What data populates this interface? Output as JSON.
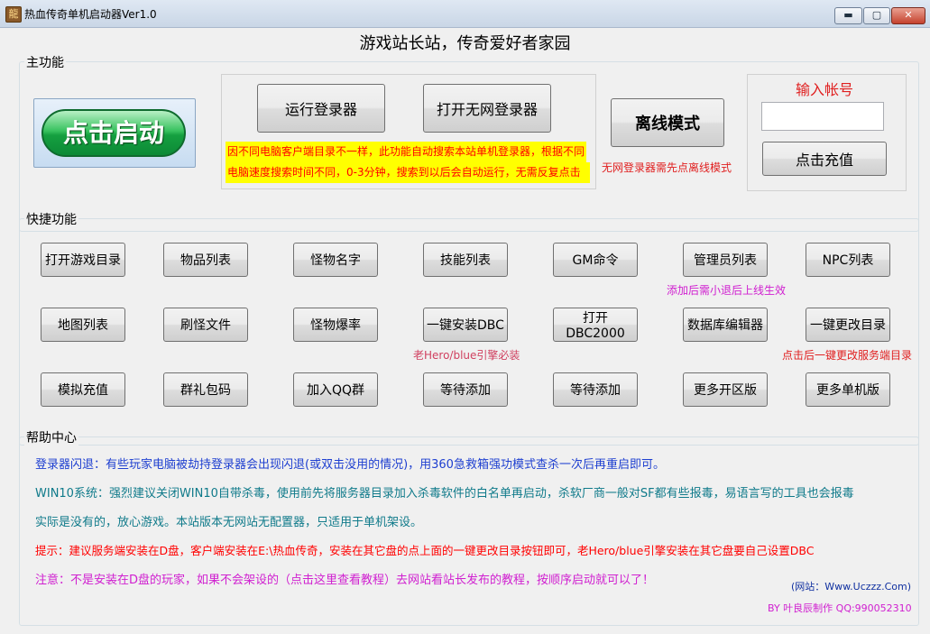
{
  "window": {
    "title": "热血传奇单机启动器Ver1.0",
    "icon_glyph": "龍",
    "minimize_glyph": "▬",
    "maximize_glyph": "▢",
    "close_glyph": "✕"
  },
  "slogan": "游戏站长站，传奇爱好者家园",
  "main_group": {
    "label": "主功能",
    "start_button": "点击启动",
    "run_login_button": "运行登录器",
    "open_offline_login_button": "打开无网登录器",
    "notice_line1": "因不同电脑客户端目录不一样，此功能自动搜索本站单机登录器，根据不同",
    "notice_line2": "电脑速度搜索时间不同，0-3分钟，搜索到以后会自动运行，无需反复点击",
    "offline_mode_button": "离线模式",
    "offline_note": "无网登录器需先点离线模式",
    "account_label": "输入帐号",
    "account_value": "",
    "recharge_button": "点击充值"
  },
  "quick_group": {
    "label": "快捷功能",
    "row1": [
      "打开游戏目录",
      "物品列表",
      "怪物名字",
      "技能列表",
      "GM命令",
      "管理员列表",
      "NPC列表"
    ],
    "row2": [
      "地图列表",
      "刷怪文件",
      "怪物爆率",
      "一键安装DBC",
      "打开DBC2000",
      "数据库编辑器",
      "一键更改目录"
    ],
    "row3": [
      "模拟充值",
      "群礼包码",
      "加入QQ群",
      "等待添加",
      "等待添加",
      "更多开区版",
      "更多单机版"
    ],
    "admin_note": "添加后需小退后上线生效",
    "dbc_note": "老Hero/blue引擎必装",
    "dir_note": "点击后一键更改服务端目录"
  },
  "help_group": {
    "label": "帮助中心",
    "line1": "登录器闪退：有些玩家电脑被劫持登录器会出现闪退(或双击没用的情况)，用360急救箱强功模式查杀一次后再重启即可。",
    "line2": "WIN10系统：强烈建议关闭WIN10自带杀毒，使用前先将服务器目录加入杀毒软件的白名单再启动，杀软厂商一般对SF都有些报毒，易语言写的工具也会报毒",
    "line3": "实际是没有的，放心游戏。本站版本无网站无配置器，只适用于单机架设。",
    "line4": "提示：建议服务端安装在D盘，客户端安装在E:\\热血传奇，安装在其它盘的点上面的一键更改目录按钮即可，老Hero/blue引擎安装在其它盘要自己设置DBC",
    "line5": "注意：不是安装在D盘的玩家，如果不会架设的（点击这里查看教程）去网站看站长发布的教程，按顺序启动就可以了！",
    "website": "(网站：Www.Uczzz.Com)",
    "credit": "BY 叶良辰制作 QQ:990052310"
  }
}
